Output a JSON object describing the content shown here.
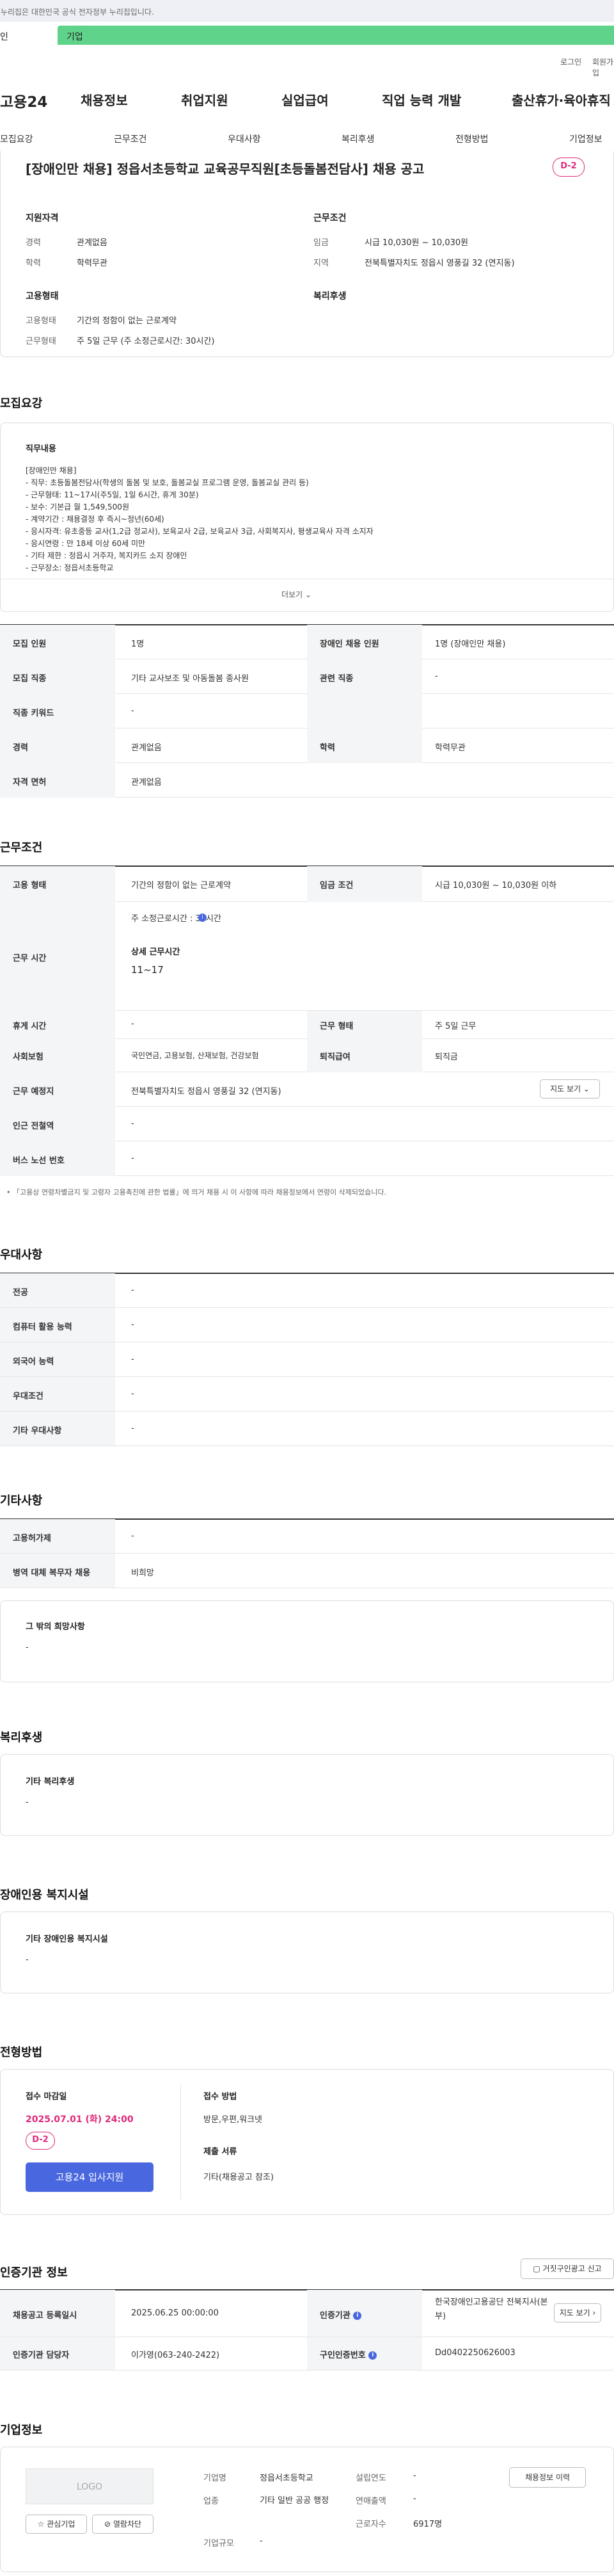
{
  "banner": {
    "text": "이 누리집은 대한민국 공식 전자정부 누리집입니다."
  },
  "top_tabs": {
    "person": "인",
    "corp": "기업"
  },
  "util": {
    "login": "로그인",
    "join": "회원가입"
  },
  "gnb": {
    "logo": "고용24",
    "items": [
      "채용정보",
      "취업지원",
      "실업급여",
      "직업 능력 개발",
      "출산휴가·육아휴직"
    ]
  },
  "subnav": {
    "items": [
      "모집요강",
      "근무조건",
      "우대사항",
      "복리후생",
      "전형방법",
      "기업정보"
    ]
  },
  "job": {
    "title": "[장애인만 채용] 정읍서초등학교 교육공무직원[초등돌봄전담사] 채용 공고",
    "dday": "D-2",
    "qual_title": "지원자격",
    "career_l": "경력",
    "career_v": "관계없음",
    "edu_l": "학력",
    "edu_v": "학력무관",
    "cond_title": "근무조건",
    "wage_l": "임금",
    "wage_v": "시급 10,030원 ~ 10,030원",
    "loc_l": "지역",
    "loc_v": "전북특별자치도 정읍시 영풍길 32 (연지동)",
    "emp_title": "고용형태",
    "emp_type_l": "고용형태",
    "emp_type_v": "기간의 정함이 없는 근로계약",
    "work_type_l": "근무형태",
    "work_type_v": "주 5일 근무 (주 소정근로시간: 30시간)",
    "welfare_title": "복리후생"
  },
  "recruit": {
    "heading": "모집요강",
    "duty_title": "직무내용",
    "duty_text": "[장애인만 채용]\n- 직무: 초등돌봄전담사(학생의 돌봄 및 보호, 돌봄교실 프로그램 운영, 돌봄교실 관리 등)\n- 근무형태: 11~17시(주5일, 1일 6시간, 휴게 30분)\n- 보수: 기본급 월 1,549,500원\n- 계약기간 : 채용결정 후 즉시~정년(60세)\n- 응시자격: 유초중등 교사(1,2급 정교사), 보육교사 2급, 보육교사 3급, 사회복지사, 평생교육사 자격 소지자\n- 응시연령 : 만 18세 이상 60세 미만\n- 기타 제한 : 정읍시 거주자, 복지카드 소지 장애인\n- 근무장소: 정읍서초등학교",
    "more": "더보기",
    "rows": [
      [
        "모집 인원",
        "1명",
        "장애인 채용 인원",
        "1명 (장애인만 채용)"
      ],
      [
        "모집 직종",
        "기타 교사보조 및 아동돌봄 종사원",
        "관련 직종",
        "-"
      ],
      [
        "직종 키워드",
        "-",
        "",
        ""
      ],
      [
        "경력",
        "관계없음",
        "학력",
        "학력무관"
      ],
      [
        "자격 면허",
        "관계없음",
        "",
        ""
      ]
    ]
  },
  "work": {
    "heading": "근무조건",
    "emp_l": "고용 형태",
    "emp_v": "기간의 정함이 없는 근로계약",
    "wage_l": "임금 조건",
    "wage_v": "시급 10,030원 ~ 10,030원 이하",
    "hours_l": "근무 시간",
    "hours_week": "주 소정근로시간 : 30시간",
    "hours_detail_l": "상세 근무시간",
    "hours_detail_v": "11~17",
    "rest_l": "휴게 시간",
    "rest_v": "-",
    "form_l": "근무 형태",
    "form_v": "주 5일 근무",
    "ins_l": "사회보험",
    "ins_v": "국민연금, 고용보험, 산재보험, 건강보험",
    "sev_l": "퇴직급여",
    "sev_v": "퇴직금",
    "place_l": "근무 예정지",
    "place_v": "전북특별자치도 정읍시 영풍길 32 (연지동)",
    "map_btn": "지도 보기",
    "sub_l": "인근 전철역",
    "sub_v": "-",
    "bus_l": "버스 노선 번호",
    "bus_v": "-",
    "note": "「고용상 연령차별금지 및 고령자 고용촉진에 관한 법률」에 의거 채용 시 이 사항에 따라 채용정보에서 연령이 삭제되었습니다."
  },
  "pref": {
    "heading": "우대사항",
    "rows": [
      [
        "전공",
        "-"
      ],
      [
        "컴퓨터 활용 능력",
        "-"
      ],
      [
        "외국어 능력",
        "-"
      ],
      [
        "우대조건",
        "-"
      ],
      [
        "기타 우대사항",
        "-"
      ]
    ]
  },
  "etc": {
    "heading": "기타사항",
    "rows": [
      [
        "고용허가제",
        "-"
      ],
      [
        "병역 대체 복무자 채용",
        "비희망"
      ]
    ],
    "hope_title": "그 밖의 희망사항",
    "hope_v": "-"
  },
  "welfare": {
    "heading": "복리후생",
    "title": "기타 복리후생",
    "v": "-"
  },
  "disab": {
    "heading": "장애인용 복지시설",
    "title": "기타 장애인용 복지시설",
    "v": "-"
  },
  "selection": {
    "heading": "전형방법",
    "deadline_l": "접수 마감일",
    "deadline_v": "2025.07.01 (화) 24:00",
    "dday": "D-2",
    "apply_btn": "고용24 입사지원",
    "method_l": "접수 방법",
    "method_v": "방문,우편,워크넷",
    "docs_l": "제출 서류",
    "docs_v": "기타(채용공고 참조)"
  },
  "agency": {
    "heading": "인증기관 정보",
    "report_btn": "거짓구인광고 신고",
    "reg_l": "채용공고 등록일시",
    "reg_v": "2025.06.25 00:00:00",
    "inst_l": "인증기관",
    "inst_v": "한국장애인고용공단 전북지사(본부)",
    "map_btn": "지도 보기",
    "mgr_l": "인증기관 담당자",
    "mgr_v": "이가영(063-240-2422)",
    "no_l": "구인인증번호",
    "no_v": "Dd0402250626003"
  },
  "company": {
    "heading": "기업정보",
    "logo": "LOGO",
    "fav_btn": "관심기업",
    "block_btn": "열람차단",
    "history_btn": "채용정보 이력",
    "name_l": "기업명",
    "name_v": "정읍서초등학교",
    "ind_l": "업종",
    "ind_v": "기타 일반 공공 행정",
    "size_l": "기업규모",
    "size_v": "-",
    "est_l": "설립연도",
    "est_v": "-",
    "sales_l": "연매출액",
    "sales_v": "-",
    "emp_l": "근로자수",
    "emp_v": "6917명"
  },
  "colors": {
    "accent": "#4968e0",
    "dday": "#e0287a",
    "corp_tab": "#5fd389"
  }
}
